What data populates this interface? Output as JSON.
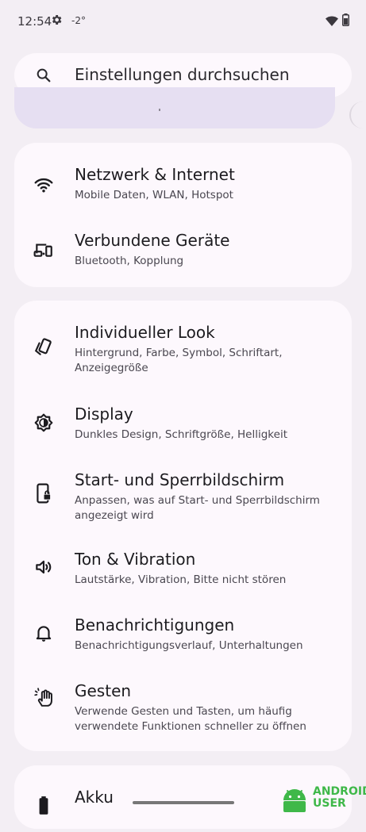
{
  "status": {
    "time": "12:54",
    "temperature": "-2°"
  },
  "search": {
    "label": "Einstellungen durchsuchen"
  },
  "settings": [
    {
      "title": "Netzwerk & Internet",
      "subtitle": "Mobile Daten, WLAN, Hotspot",
      "icon": "wifi-icon"
    },
    {
      "title": "Verbundene Geräte",
      "subtitle": "Bluetooth, Kopplung",
      "icon": "connected-devices-icon"
    },
    {
      "title": "Individueller Look",
      "subtitle": "Hintergrund, Farbe, Symbol, Schriftart, Anzeigegröße",
      "icon": "palette-icon"
    },
    {
      "title": "Display",
      "subtitle": "Dunkles Design, Schriftgröße, Helligkeit",
      "icon": "brightness-icon"
    },
    {
      "title": "Start- und Sperrbildschirm",
      "subtitle": "Anpassen, was auf Start- und Sperrbildschirm angezeigt wird",
      "icon": "phone-lock-icon"
    },
    {
      "title": "Ton & Vibration",
      "subtitle": "Lautstärke, Vibration, Bitte nicht stören",
      "icon": "volume-icon"
    },
    {
      "title": "Benachrichtigungen",
      "subtitle": "Benachrichtigungsverlauf, Unterhaltungen",
      "icon": "bell-icon"
    },
    {
      "title": "Gesten",
      "subtitle": "Verwende Gesten und Tasten, um häufig verwendete Funktionen schneller zu öffnen",
      "icon": "gesture-icon"
    },
    {
      "title": "Akku",
      "icon": "battery-icon"
    }
  ],
  "watermark": {
    "line1": "ANDROID",
    "line2": "USER"
  },
  "colors": {
    "background": "#f3eef4",
    "card": "#fdf8fd",
    "peek_card": "#e6dff2",
    "logo_green": "#3fb849"
  }
}
